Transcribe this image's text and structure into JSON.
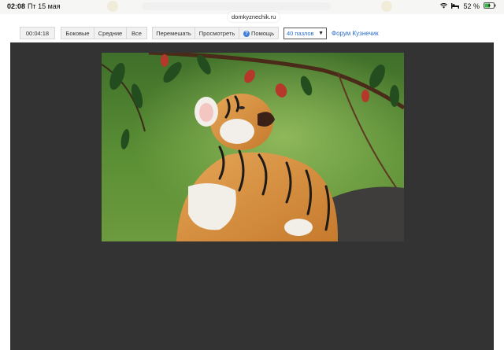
{
  "status_bar": {
    "time": "02:08",
    "date": "Пт 15 мая",
    "battery_percent": "52 %",
    "url": "domkyznechik.ru"
  },
  "toolbar": {
    "timer": "00:04:18",
    "edges_label": "Боковые",
    "middle_label": "Средние",
    "all_label": "Все",
    "shuffle_label": "Перемешать",
    "preview_label": "Просмотреть",
    "help_label": "Помощь",
    "pieces_select_value": "40 пазлов",
    "forum_link": "Форум Кузнечик"
  },
  "colors": {
    "board_bg": "#333333",
    "link": "#2a6bc9",
    "help_icon": "#3d7fd9"
  },
  "puzzle": {
    "subject": "tiger cub on rock",
    "pieces": 40
  }
}
